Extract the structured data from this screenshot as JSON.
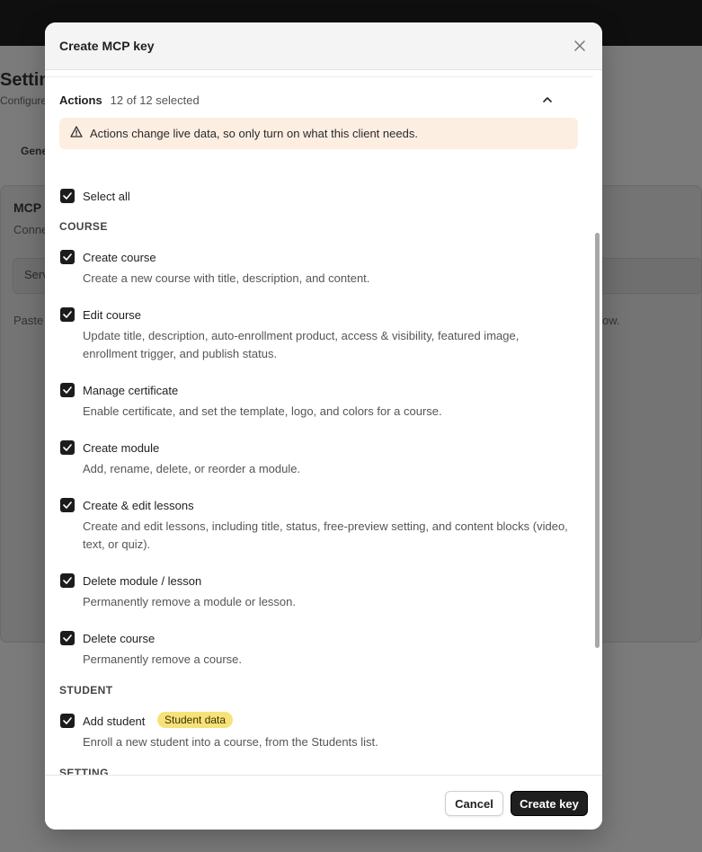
{
  "background": {
    "title": "Settin",
    "subtitle": "Configure",
    "tab": "Gene",
    "card_title": "MCP",
    "card_sub": "Conne",
    "field_label": "Serv",
    "paste_text": "Paste",
    "tail_text": "ow."
  },
  "modal": {
    "title": "Create MCP key",
    "close_icon": "close-icon"
  },
  "actions": {
    "title": "Actions",
    "count": "12 of 12 selected",
    "warning": "Actions change live data, so only turn on what this client needs.",
    "select_all": "Select all",
    "groups": [
      {
        "name": "COURSE"
      },
      {
        "name": "STUDENT"
      },
      {
        "name": "SETTING"
      }
    ],
    "items": [
      {
        "label": "Create course",
        "desc": "Create a new course with title, description, and content.",
        "checked": true
      },
      {
        "label": "Edit course",
        "desc": "Update title, description, auto-enrollment product, access & visibility, featured image, enrollment trigger, and publish status.",
        "checked": true
      },
      {
        "label": "Manage certificate",
        "desc": "Enable certificate, and set the template, logo, and colors for a course.",
        "checked": true
      },
      {
        "label": "Create module",
        "desc": "Add, rename, delete, or reorder a module.",
        "checked": true
      },
      {
        "label": "Create & edit lessons",
        "desc": "Create and edit lessons, including title, status, free-preview setting, and content blocks (video, text, or quiz).",
        "checked": true
      },
      {
        "label": "Delete module / lesson",
        "desc": "Permanently remove a module or lesson.",
        "checked": true
      },
      {
        "label": "Delete course",
        "desc": "Permanently remove a course.",
        "checked": true
      },
      {
        "label": "Add student",
        "badge": "Student data",
        "desc": "Enroll a new student into a course, from the Students list.",
        "checked": true
      }
    ]
  },
  "footer": {
    "cancel": "Cancel",
    "create": "Create key"
  },
  "colors": {
    "warning_bg": "#fdeee2",
    "badge_bg": "#f7e27a",
    "primary": "#1f1f1f"
  }
}
